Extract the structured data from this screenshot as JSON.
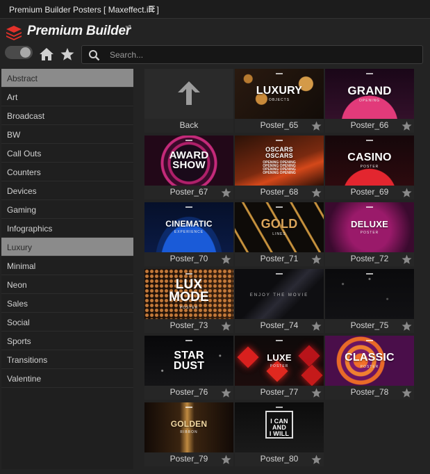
{
  "window": {
    "title": "Premium Builder Posters [ Maxeffect.iR ]",
    "menu_glyph": "☰"
  },
  "brand": {
    "name": "Premium Builder",
    "version": "v3"
  },
  "toolbar": {
    "home_icon": "home-icon",
    "star_icon": "star-icon"
  },
  "search": {
    "placeholder": "Search...",
    "value": ""
  },
  "categories": [
    "Abstract",
    "Art",
    "Broadcast",
    "BW",
    "Call Outs",
    "Counters",
    "Devices",
    "Gaming",
    "Infographics",
    "Luxury",
    "Minimal",
    "Neon",
    "Sales",
    "Social",
    "Sports",
    "Transitions",
    "Valentine"
  ],
  "highlighted_categories": [
    "Abstract",
    "Luxury"
  ],
  "back": {
    "label": "Back"
  },
  "posters": [
    {
      "label": "Poster_65",
      "line1": "LUXURY",
      "line2": "OBJECTS"
    },
    {
      "label": "Poster_66",
      "line1": "GRAND",
      "line2": "OPENING"
    },
    {
      "label": "Poster_67",
      "line1": "AWARD\nSHOW",
      "line2": ""
    },
    {
      "label": "Poster_68",
      "line1": "OSCARS\nOSCARS",
      "line2": "OPENING OPENING OPENING OPENING OPENING OPENING OPENING OPENING"
    },
    {
      "label": "Poster_69",
      "line1": "CASINO",
      "line2": "POSTER"
    },
    {
      "label": "Poster_70",
      "line1": "CINEMATIC",
      "line2": "EXPERIENCE"
    },
    {
      "label": "Poster_71",
      "line1": "GOLD",
      "line2": "LINES"
    },
    {
      "label": "Poster_72",
      "line1": "DELUXE",
      "line2": "POSTER"
    },
    {
      "label": "Poster_73",
      "line1": "LUX\nMODE",
      "line2": "POSTER"
    },
    {
      "label": "Poster_74",
      "line1": "",
      "line2": "ENJOY THE MOVIE"
    },
    {
      "label": "Poster_75",
      "line1": "",
      "line2": ""
    },
    {
      "label": "Poster_76",
      "line1": "STAR\nDUST",
      "line2": ""
    },
    {
      "label": "Poster_77",
      "line1": "LUXE",
      "line2": "POSTER"
    },
    {
      "label": "Poster_78",
      "line1": "CLASSIC",
      "line2": "POSTER"
    },
    {
      "label": "Poster_79",
      "line1": "GOLDEN",
      "line2": "RIBBON"
    },
    {
      "label": "Poster_80",
      "line1": "I CAN\nAND\nI WILL",
      "line2": ""
    }
  ],
  "colors": {
    "accent": "#e2312a",
    "selected_category_bg": "#8b8b8b",
    "star": "#8a8a8a"
  }
}
